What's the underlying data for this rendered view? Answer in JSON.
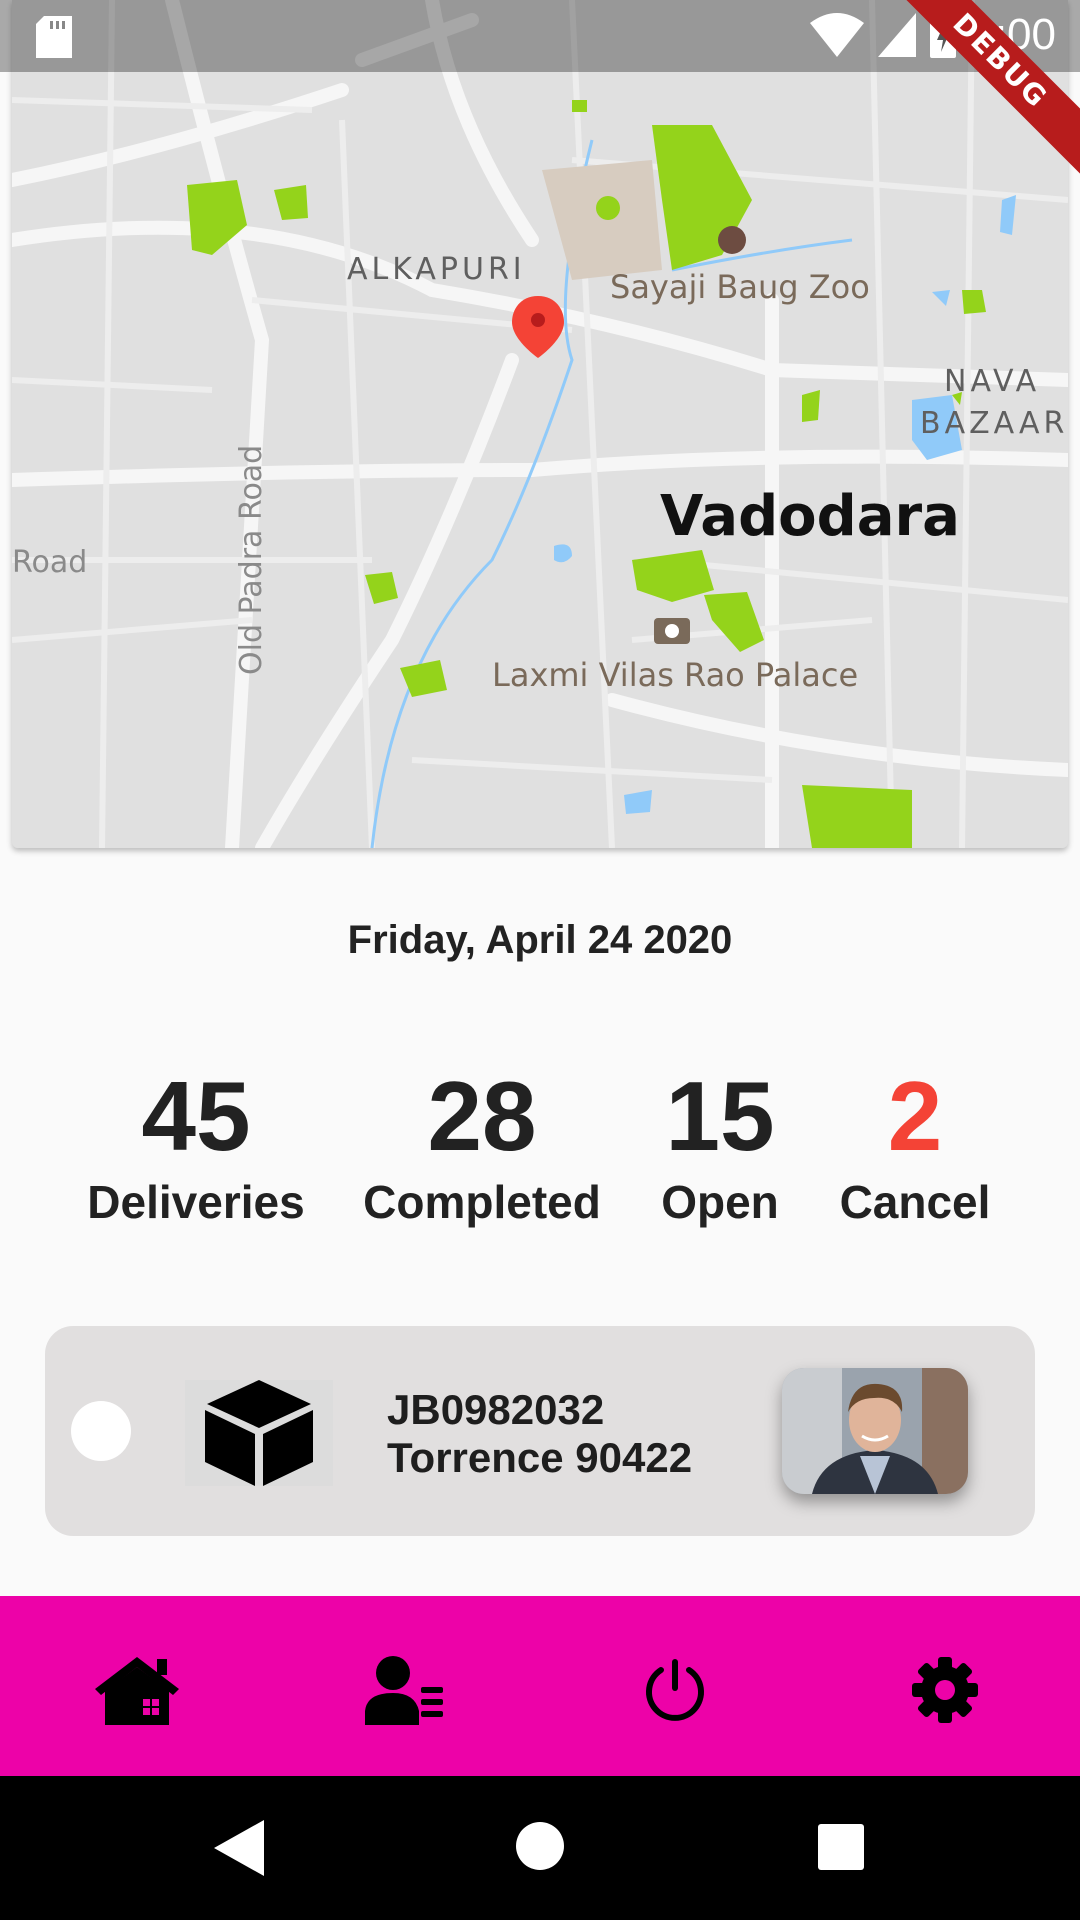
{
  "status_bar": {
    "time": "1:00",
    "debug_label": "DEBUG"
  },
  "map": {
    "labels": {
      "alkapuri": "ALKAPURI",
      "zoo": "Sayaji Baug Zoo",
      "nava": "NAVA",
      "bazaar": "BAZAAR",
      "city": "Vadodara",
      "palace": "Laxmi Vilas Rao Palace",
      "old_padra": "Old Padra Road",
      "road": "Road"
    },
    "colors": {
      "park": "#94d31b",
      "water": "#90caf9",
      "land": "#e0e0e0",
      "road": "#f5f5f5",
      "marker": "#f44336"
    }
  },
  "date": "Friday, April 24 2020",
  "stats": [
    {
      "value": "45",
      "label": "Deliveries"
    },
    {
      "value": "28",
      "label": "Completed"
    },
    {
      "value": "15",
      "label": "Open"
    },
    {
      "value": "2",
      "label": "Cancel"
    }
  ],
  "delivery": {
    "id": "JB0982032",
    "location": "Torrence 90422",
    "icon": "package-icon"
  },
  "bottom_nav": {
    "color": "#ed02a8",
    "items": [
      "home-icon",
      "user-list-icon",
      "power-icon",
      "settings-icon"
    ]
  }
}
